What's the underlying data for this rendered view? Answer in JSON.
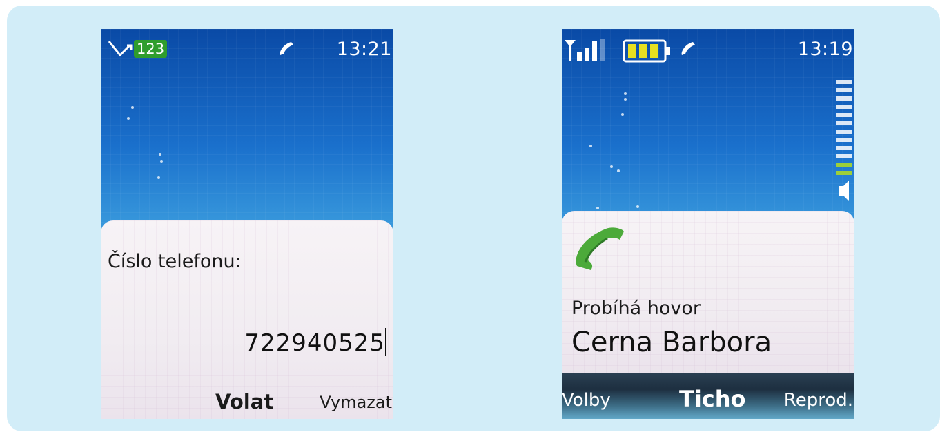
{
  "left_screen": {
    "status": {
      "mode_badge": "123",
      "time": "13:21"
    },
    "panel": {
      "label": "Číslo telefonu:",
      "value": "722940525"
    },
    "softkeys": {
      "center": "Volat",
      "right": "Vymazat"
    }
  },
  "right_screen": {
    "status": {
      "time": "13:19",
      "volume_level": 0.2
    },
    "panel": {
      "call_status": "Probíhá hovor",
      "caller_name": "Cerna Barbora"
    },
    "softkeys": {
      "left": "Volby",
      "center": "Ticho",
      "right": "Reprod."
    }
  },
  "colors": {
    "background": "#d2edf8",
    "screen_blue": "#1a70cc",
    "badge_green": "#2f9d2d",
    "handset_green": "#4caa3a",
    "battery_yellow": "#e8e020"
  },
  "icons": [
    "missed-call-icon",
    "handset-icon",
    "signal-strength-icon",
    "battery-icon",
    "volume-icon",
    "call-handset-icon"
  ]
}
